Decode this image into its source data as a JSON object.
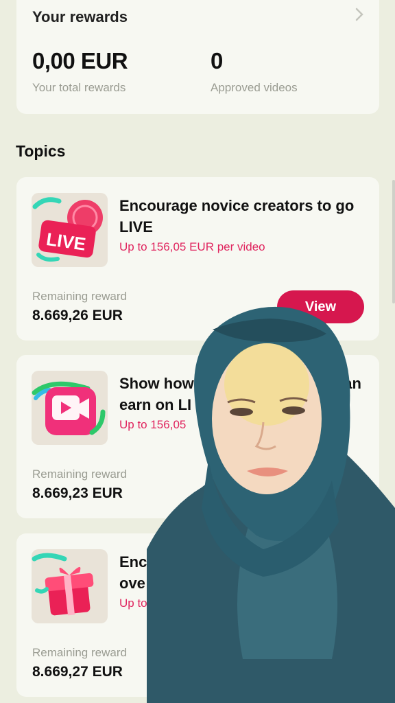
{
  "rewards": {
    "title": "Your rewards",
    "total_value": "0,00 EUR",
    "total_label": "Your total rewards",
    "videos_value": "0",
    "videos_label": "Approved videos"
  },
  "topics_heading": "Topics",
  "topics": [
    {
      "title": "Encourage novice creators to go LIVE",
      "subtitle": "Up to 156,05 EUR per video",
      "remaining_label": "Remaining reward",
      "remaining_value": "8.669,26 EUR",
      "button": "View",
      "icon": "live-badge-icon",
      "badge_text": "LIVE"
    },
    {
      "title": "Show how",
      "title_right": "can",
      "title_line2": "earn on LI",
      "subtitle": "Up to 156,05",
      "remaining_label": "Remaining reward",
      "remaining_value": "8.669,23 EUR",
      "icon": "video-camera-icon"
    },
    {
      "title": "Enc",
      "title_line2": "ove",
      "subtitle": "Up to",
      "remaining_label": "Remaining reward",
      "remaining_value": "8.669,27 EUR",
      "icon": "gift-box-icon"
    }
  ],
  "colors": {
    "accent": "#d6174e",
    "subtitle": "#e0245e",
    "background": "#eceee0",
    "card": "#f7f8f2"
  }
}
